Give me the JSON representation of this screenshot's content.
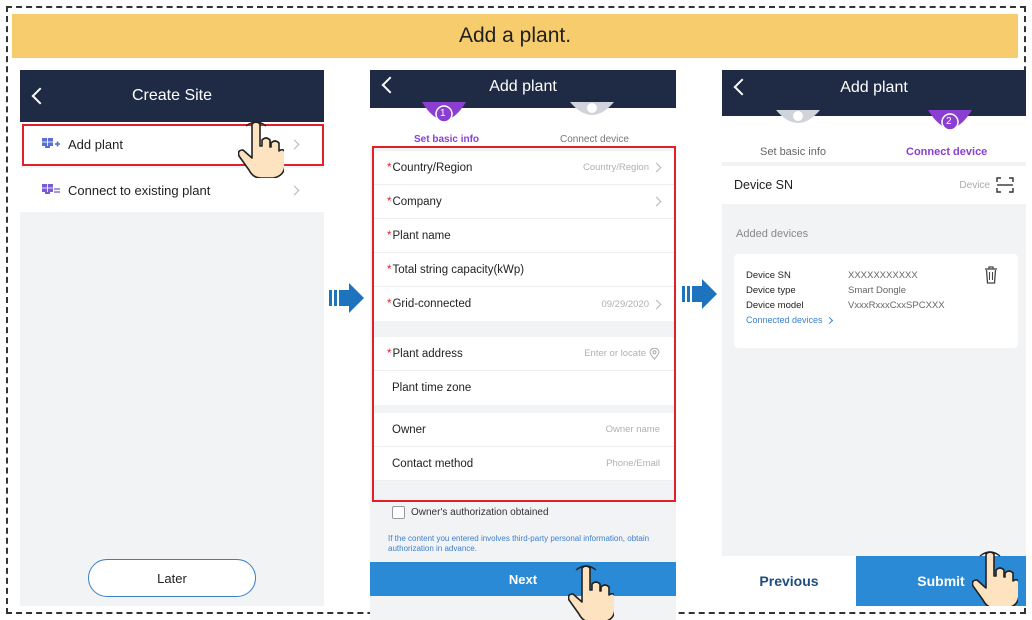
{
  "banner": {
    "title": "Add a plant."
  },
  "screen1": {
    "title": "Create Site",
    "menu": [
      {
        "label": "Add plant",
        "icon": "add-plant-icon"
      },
      {
        "label": "Connect to existing plant",
        "icon": "connect-plant-icon"
      }
    ],
    "later_button": "Later"
  },
  "screen2": {
    "title": "Add plant",
    "steps": [
      {
        "number": "1",
        "label": "Set basic info",
        "active": true
      },
      {
        "number": "2",
        "label": "Connect device",
        "active": false
      }
    ],
    "fields": [
      {
        "label": "Country/Region",
        "required": "*",
        "value": "Country/Region",
        "chevron": true
      },
      {
        "label": "Company",
        "required": "*",
        "value": "",
        "chevron": true
      },
      {
        "label": "Plant name",
        "required": "*",
        "value": "",
        "chevron": false
      },
      {
        "label": "Total string capacity(kWp)",
        "required": "*",
        "value": "",
        "chevron": false
      },
      {
        "label": "Grid-connected",
        "required": "*",
        "value": "09/29/2020",
        "chevron": true
      },
      {
        "label": "Plant address",
        "required": "*",
        "value": "Enter or locate",
        "chevron": false
      },
      {
        "label": "Plant time zone",
        "required": "",
        "value": "",
        "chevron": false
      },
      {
        "label": "Owner",
        "required": "",
        "value": "Owner name",
        "chevron": false
      },
      {
        "label": "Contact method",
        "required": "",
        "value": "Phone/Email",
        "chevron": false
      }
    ],
    "authorization_label": "Owner's authorization obtained",
    "note": "If the content you entered involves third-party personal information, obtain authorization in advance.",
    "next_button": "Next"
  },
  "screen3": {
    "title": "Add plant",
    "steps": [
      {
        "number": "1",
        "label": "Set basic info",
        "active": false
      },
      {
        "number": "2",
        "label": "Connect device",
        "active": true
      }
    ],
    "device_sn_label": "Device SN",
    "device_sn_value": "Device",
    "added_devices_label": "Added devices",
    "device": {
      "sn_label": "Device SN",
      "sn_value": "XXXXXXXXXXX",
      "type_label": "Device type",
      "type_value": "Smart Dongle",
      "model_label": "Device model",
      "model_value": "VxxxRxxxCxxSPCXXX",
      "connected_link": "Connected devices"
    },
    "previous_button": "Previous",
    "submit_button": "Submit"
  },
  "colors": {
    "banner": "#f6cc6d",
    "header_navy": "#1f2b45",
    "accent_purple": "#8a3fd1",
    "button_blue": "#2b8ad6",
    "highlight_red": "#e2202a",
    "arrow_blue": "#1e73be"
  }
}
